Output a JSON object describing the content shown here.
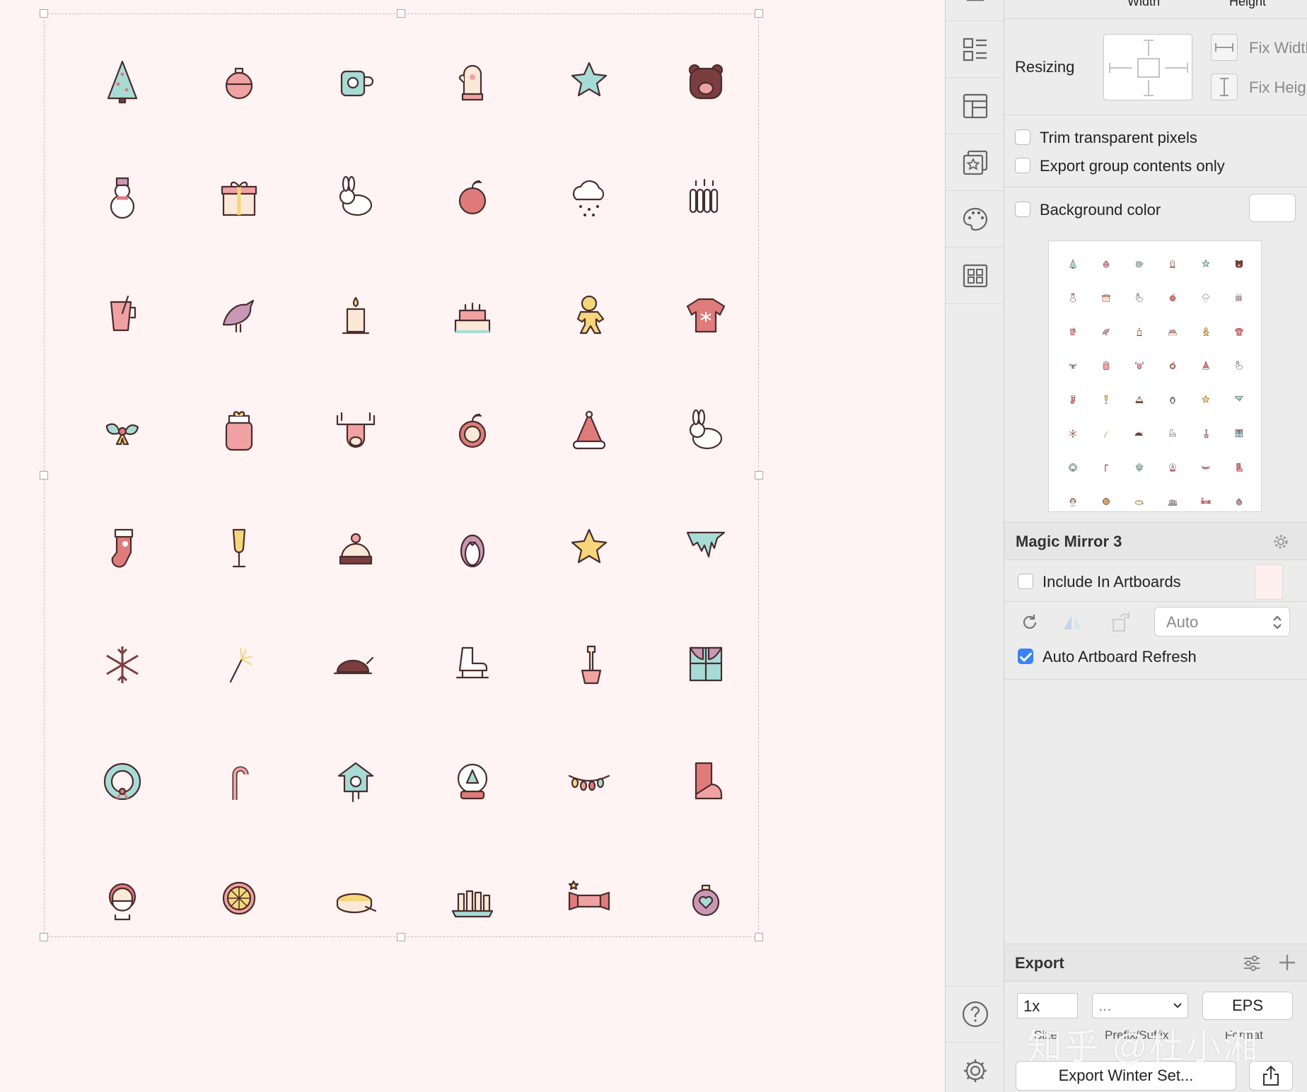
{
  "inspector": {
    "dimensions": {
      "width_label": "Width",
      "height_label": "Height"
    },
    "resizing": {
      "label": "Resizing",
      "fix_width": "Fix Width",
      "fix_height": "Fix Height"
    },
    "options": {
      "trim_transparent": "Trim transparent pixels",
      "export_group_contents": "Export group contents only",
      "background_color": "Background color"
    },
    "magic_mirror": {
      "title": "Magic Mirror 3",
      "include_in_artboards": "Include In Artboards",
      "mode_value": "Auto",
      "auto_refresh": "Auto Artboard Refresh",
      "auto_refresh_checked": true
    },
    "export": {
      "title": "Export",
      "size_value": "1x",
      "size_label": "Size",
      "prefix_value": "...",
      "prefix_label": "Prefix/Suffix",
      "format_value": "EPS",
      "format_label": "Format",
      "export_button": "Export Winter Set...",
      "share_icon": "share-icon"
    }
  },
  "toolbar": [
    "layers-list-icon",
    "layout-icon",
    "symbols-icon",
    "palette-icon",
    "grid-layout-icon",
    "help-icon",
    "settings-icon"
  ],
  "canvas": {
    "icons": [
      "christmas-tree-icon",
      "bauble-icon",
      "hot-cocoa-mug-icon",
      "mitten-icon",
      "star-wreath-icon",
      "bear-icon",
      "snowman-icon",
      "gift-box-icon",
      "rabbit-icon",
      "apple-icon",
      "snow-cloud-icon",
      "radiator-icon",
      "mulled-wine-icon",
      "bird-icon",
      "candle-icon",
      "birthday-cake-icon",
      "gingerbread-man-icon",
      "sweater-icon",
      "holly-bow-icon",
      "jam-jar-icon",
      "moose-icon",
      "apple-face-icon",
      "santa-hat-icon",
      "bunny-icon",
      "stocking-icon",
      "champagne-icon",
      "beanie-icon",
      "penguin-icon",
      "star-icon",
      "icicles-icon",
      "snowflake-icon",
      "sparkler-icon",
      "roast-turkey-icon",
      "ice-skate-icon",
      "snow-shovel-icon",
      "window-icon",
      "wreath-icon",
      "candy-cane-icon",
      "cuckoo-clock-icon",
      "snow-globe-icon",
      "string-lights-icon",
      "boot-icon",
      "santa-icon",
      "orange-slice-icon",
      "pie-icon",
      "advent-candles-icon",
      "cracker-candy-icon",
      "heart-ornament-icon"
    ]
  },
  "watermark": "知乎 @杜小湘",
  "colors": {
    "accent": "#3b82f6",
    "canvas_bg": "#fff3f3",
    "panel_bg": "#ececec"
  }
}
